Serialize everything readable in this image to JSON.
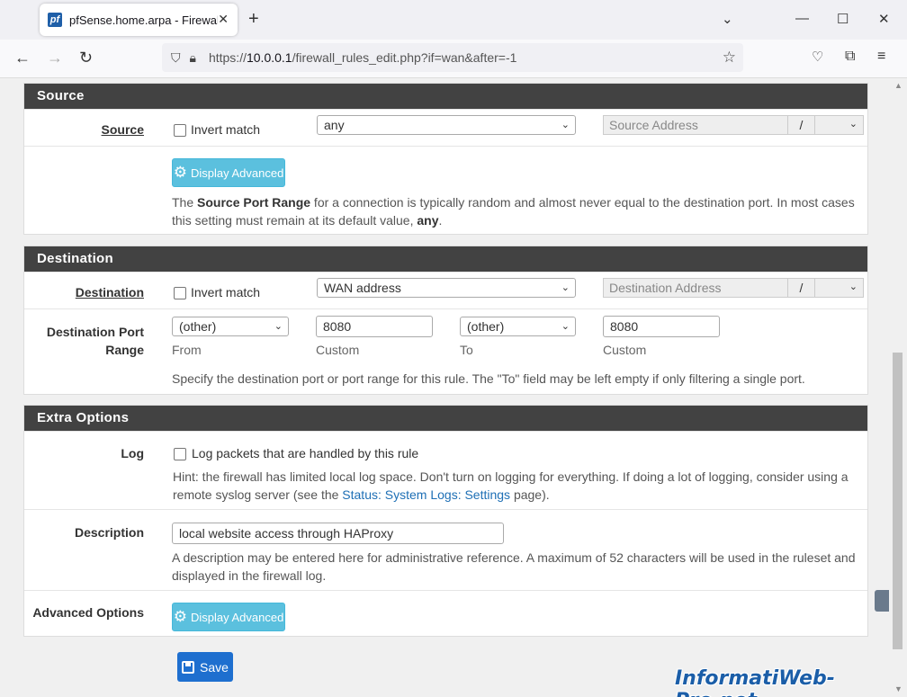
{
  "browser": {
    "tab_title": "pfSense.home.arpa - Firewall: R",
    "favicon_text": "pf",
    "url_prefix": "https://",
    "url_host": "10.0.0.1",
    "url_path": "/firewall_rules_edit.php?if=wan&after=-1"
  },
  "source": {
    "header": "Source",
    "label": "Source",
    "invert_label": "Invert match",
    "type_value": "any",
    "address_placeholder": "Source Address",
    "slash": "/",
    "advanced_button": "Display Advanced",
    "help_pre": "The ",
    "help_bold": "Source Port Range",
    "help_mid": " for a connection is typically random and almost never equal to the destination port. In most cases this setting must remain at its default value, ",
    "help_bold2": "any",
    "help_end": "."
  },
  "destination": {
    "header": "Destination",
    "label": "Destination",
    "invert_label": "Invert match",
    "type_value": "WAN address",
    "address_placeholder": "Destination Address",
    "slash": "/",
    "port_label_1": "Destination Port",
    "port_label_2": "Range",
    "from_select": "(other)",
    "from_custom": "8080",
    "to_select": "(other)",
    "to_custom": "8080",
    "sub_from": "From",
    "sub_custom1": "Custom",
    "sub_to": "To",
    "sub_custom2": "Custom",
    "help": "Specify the destination port or port range for this rule. The \"To\" field may be left empty if only filtering a single port."
  },
  "extra": {
    "header": "Extra Options",
    "log_label": "Log",
    "log_checkbox_label": "Log packets that are handled by this rule",
    "log_hint_pre": "Hint: the firewall has limited local log space. Don't turn on logging for everything. If doing a lot of logging, consider using a remote syslog server (see the ",
    "log_hint_link": "Status: System Logs: Settings",
    "log_hint_end": " page).",
    "description_label": "Description",
    "description_value": "local website access through HAProxy",
    "description_help": "A description may be entered here for administrative reference. A maximum of 52 characters will be used in the ruleset and displayed in the firewall log.",
    "advanced_label": "Advanced Options",
    "advanced_button": "Display Advanced"
  },
  "save_label": "Save",
  "watermark": "InformatiWeb-Pro.net"
}
